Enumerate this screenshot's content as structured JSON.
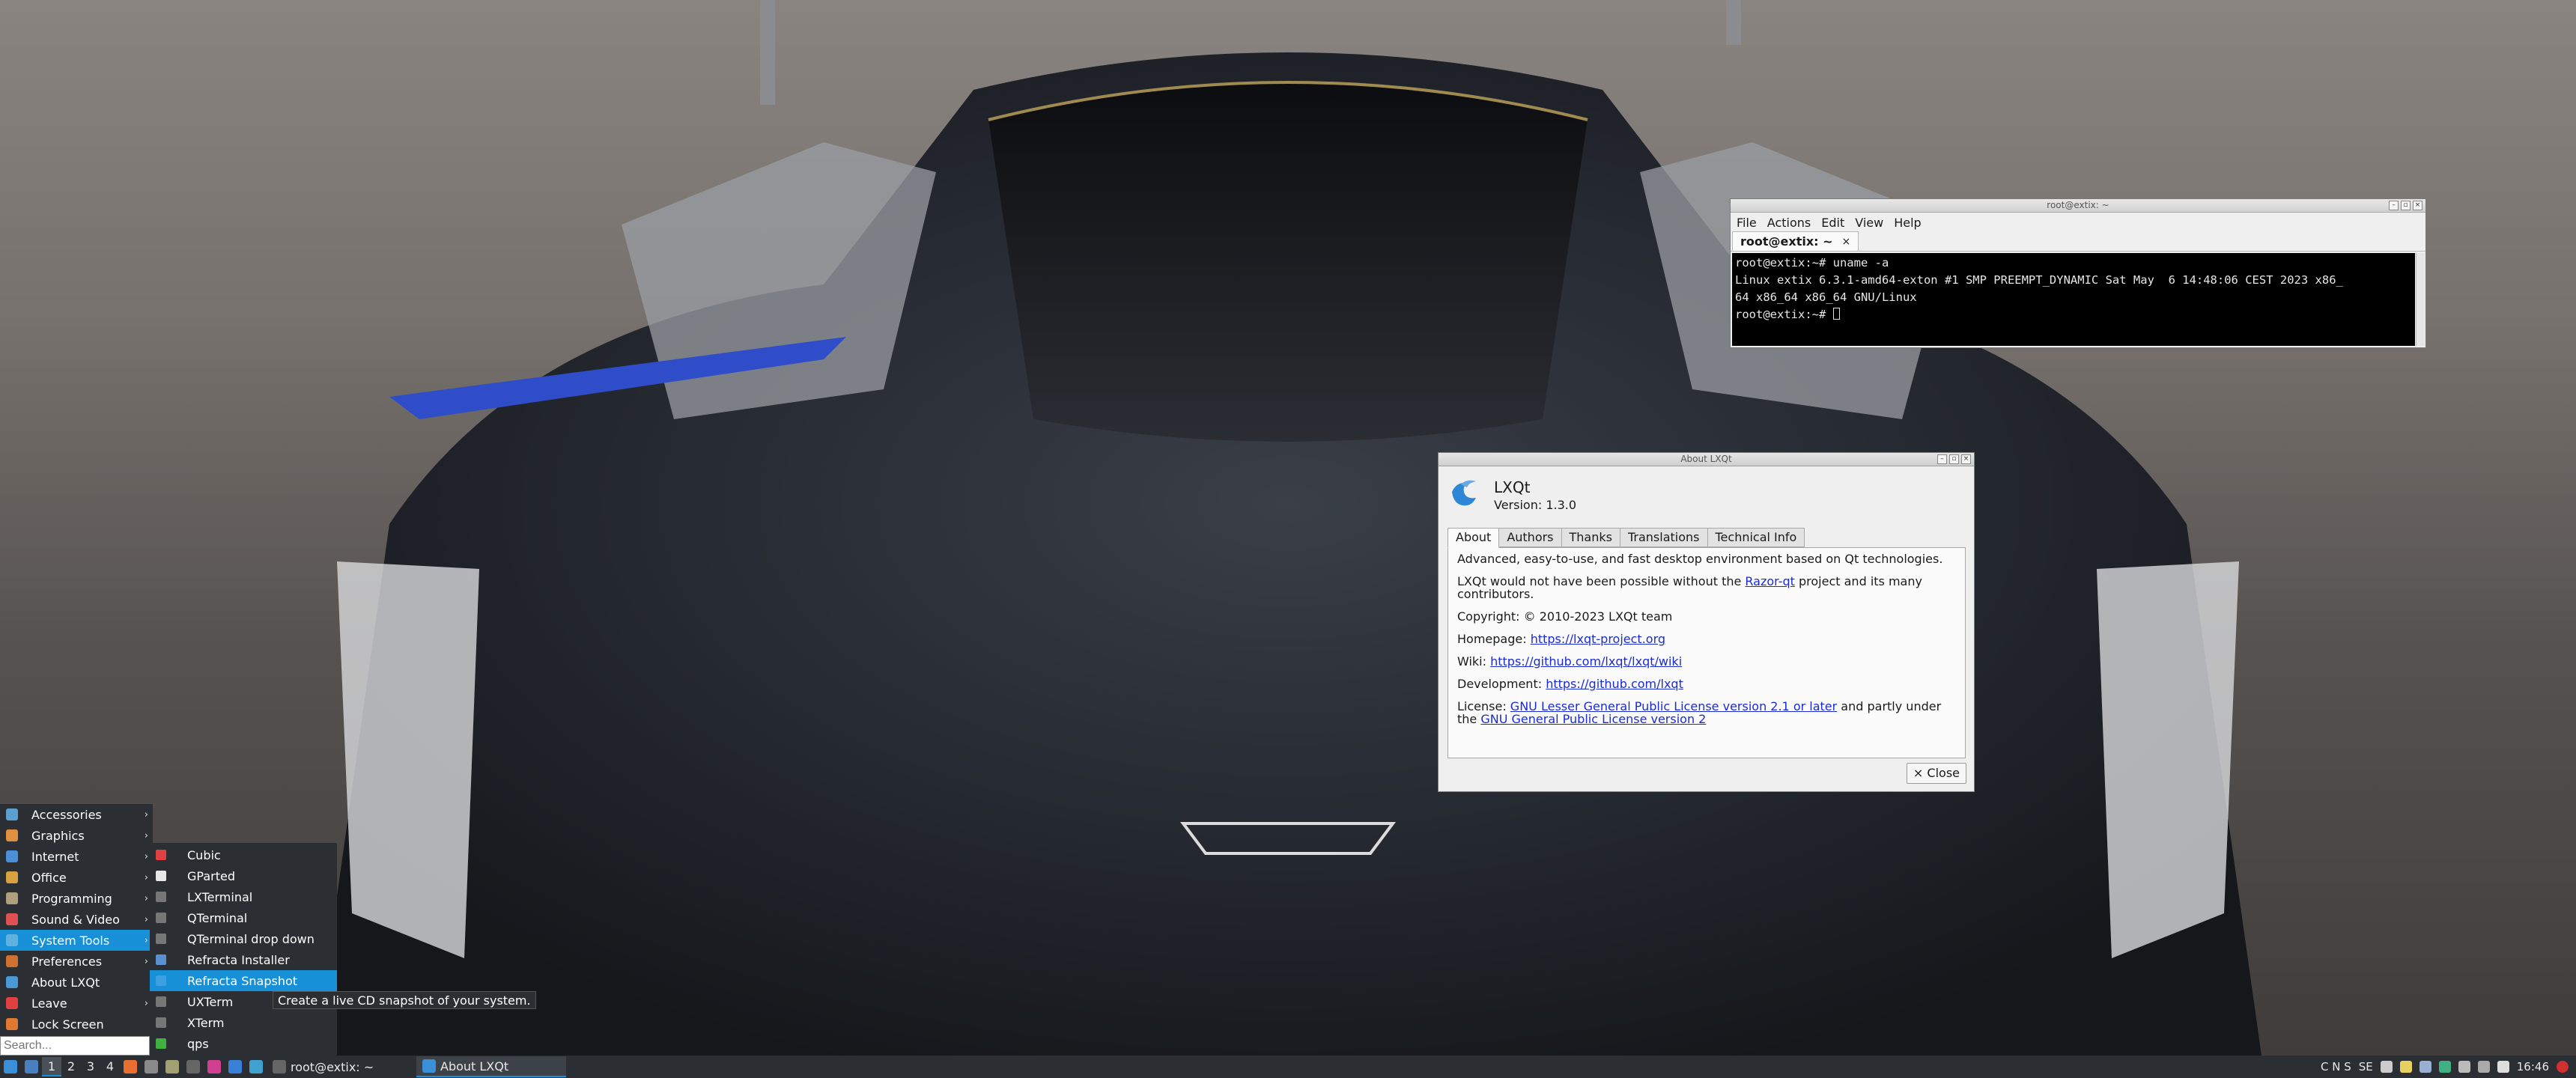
{
  "terminal": {
    "title": "root@extix: ~",
    "menu": [
      "File",
      "Actions",
      "Edit",
      "View",
      "Help"
    ],
    "tab_label": "root@extix: ~",
    "lines": [
      "root@extix:~# uname -a",
      "Linux extix 6.3.1-amd64-exton #1 SMP PREEMPT_DYNAMIC Sat May  6 14:48:06 CEST 2023 x86_",
      "64 x86_64 x86_64 GNU/Linux",
      "root@extix:~# "
    ]
  },
  "about": {
    "title": "About LXQt",
    "name": "LXQt",
    "version": "Version: 1.3.0",
    "tabs": [
      "About",
      "Authors",
      "Thanks",
      "Translations",
      "Technical Info"
    ],
    "description": "Advanced, easy-to-use, and fast desktop environment based on Qt technologies.",
    "razor_prefix": "LXQt would not have been possible without the ",
    "razor_link": "Razor-qt",
    "razor_suffix": " project and its many contributors.",
    "copyright": "Copyright: © 2010-2023 LXQt team",
    "homepage_label": "Homepage: ",
    "homepage_url": "https://lxqt-project.org",
    "wiki_label": "Wiki: ",
    "wiki_url": "https://github.com/lxqt/lxqt/wiki",
    "dev_label": "Development: ",
    "dev_url": "https://github.com/lxqt",
    "license_label": "License: ",
    "license_link1": "GNU Lesser General Public License version 2.1 or later",
    "license_mid": " and partly under the ",
    "license_link2": "GNU General Public License version 2",
    "close_label": "× Close"
  },
  "menu": {
    "items": [
      {
        "label": "Accessories",
        "color": "#5aa0d0"
      },
      {
        "label": "Graphics",
        "color": "#e09040"
      },
      {
        "label": "Internet",
        "color": "#4a8fd8"
      },
      {
        "label": "Office",
        "color": "#d8a040"
      },
      {
        "label": "Programming",
        "color": "#b0a080"
      },
      {
        "label": "Sound & Video",
        "color": "#e05050"
      },
      {
        "label": "System Tools",
        "color": "#60b0e0"
      },
      {
        "label": "Preferences",
        "color": "#d07030"
      },
      {
        "label": "About LXQt",
        "color": "#4a9ad8"
      },
      {
        "label": "Leave",
        "color": "#e04040"
      },
      {
        "label": "Lock Screen",
        "color": "#e07a30"
      }
    ],
    "search_placeholder": "Search...",
    "submenu": [
      {
        "label": "Cubic",
        "color": "#e04040"
      },
      {
        "label": "GParted",
        "color": "#e8e8e8"
      },
      {
        "label": "LXTerminal",
        "color": "#777777"
      },
      {
        "label": "QTerminal",
        "color": "#777777"
      },
      {
        "label": "QTerminal drop down",
        "color": "#777777"
      },
      {
        "label": "Refracta Installer",
        "color": "#5a8fd0"
      },
      {
        "label": "Refracta Snapshot",
        "color": "#3aa0e0"
      },
      {
        "label": "UXTerm",
        "color": "#777777"
      },
      {
        "label": "XTerm",
        "color": "#777777"
      },
      {
        "label": "qps",
        "color": "#40b040"
      }
    ],
    "tooltip": "Create a live CD snapshot of your system."
  },
  "taskbar": {
    "desktops": [
      "1",
      "2",
      "3",
      "4"
    ],
    "tasks": [
      "root@extix: ~",
      "About LXQt"
    ],
    "keyboard": "C  N  S",
    "layout": "SE",
    "clock": "16:46"
  }
}
